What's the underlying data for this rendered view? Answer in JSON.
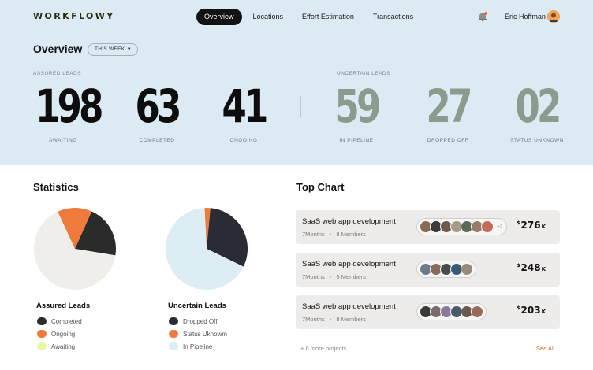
{
  "app": {
    "logo": "WORKFLOWY"
  },
  "nav": {
    "items": [
      {
        "label": "Overview",
        "active": true
      },
      {
        "label": "Locations",
        "active": false
      },
      {
        "label": "Effort Estimation",
        "active": false
      },
      {
        "label": "Transactions",
        "active": false
      }
    ]
  },
  "user": {
    "name": "Eric Hoffman",
    "icon": "notification-bell-icon"
  },
  "overview": {
    "title": "Overview",
    "period": "THIS WEEK",
    "assured": {
      "label": "ASSURED LEADS",
      "stats": [
        {
          "value": "198",
          "label": "AWAITING"
        },
        {
          "value": "63",
          "label": "COMPLETED"
        },
        {
          "value": "41",
          "label": "ONGOING"
        }
      ]
    },
    "uncertain": {
      "label": "UNCERTAIN LEADS",
      "stats": [
        {
          "value": "59",
          "label": "IN PIPELINE"
        },
        {
          "value": "27",
          "label": "DROPPED OFF"
        },
        {
          "value": "02",
          "label": "STATUS UNKNOWN"
        }
      ]
    }
  },
  "statistics": {
    "title": "Statistics",
    "charts": [
      {
        "title": "Assured Leads",
        "legend": [
          {
            "label": "Completed",
            "color": "#2b2b2b",
            "value": 63
          },
          {
            "label": "Ongoing",
            "color": "#ee7a3c",
            "value": 41
          },
          {
            "label": "Awaiting",
            "color": "#f1f5a6",
            "value": 198
          }
        ]
      },
      {
        "title": "Uncertain Leads",
        "legend": [
          {
            "label": "Dropped Off",
            "color": "#2b2b35",
            "value": 27
          },
          {
            "label": "Status Uknowm",
            "color": "#ee7a3c",
            "value": 2
          },
          {
            "label": "In Pipeline",
            "color": "#ddedf4",
            "value": 59
          }
        ]
      }
    ]
  },
  "chart_data": [
    {
      "type": "pie",
      "title": "Assured Leads",
      "labels": [
        "Completed",
        "Ongoing",
        "Awaiting"
      ],
      "values": [
        63,
        41,
        198
      ],
      "colors": [
        "#2b2b2b",
        "#ee7a3c",
        "#f1f5a6"
      ]
    },
    {
      "type": "pie",
      "title": "Uncertain Leads",
      "labels": [
        "Dropped Off",
        "Status Uknowm",
        "In Pipeline"
      ],
      "values": [
        27,
        2,
        59
      ],
      "colors": [
        "#2b2b35",
        "#ee7a3c",
        "#ddedf4"
      ]
    }
  ],
  "top_chart": {
    "title": "Top Chart",
    "projects": [
      {
        "title": "SaaS web app development",
        "duration": "7Months",
        "members": "8 Members",
        "extra_members": "+2",
        "currency": "$",
        "amount": "276",
        "unit": "K"
      },
      {
        "title": "SaaS web app development",
        "duration": "7Months",
        "members": "5 Members",
        "extra_members": "",
        "currency": "$",
        "amount": "248",
        "unit": "K"
      },
      {
        "title": "SaaS web app development",
        "duration": "7Months",
        "members": "8 Members",
        "extra_members": "",
        "currency": "$",
        "amount": "203",
        "unit": "K"
      }
    ],
    "more": "+ 6 more projects",
    "see_all": "See All"
  }
}
